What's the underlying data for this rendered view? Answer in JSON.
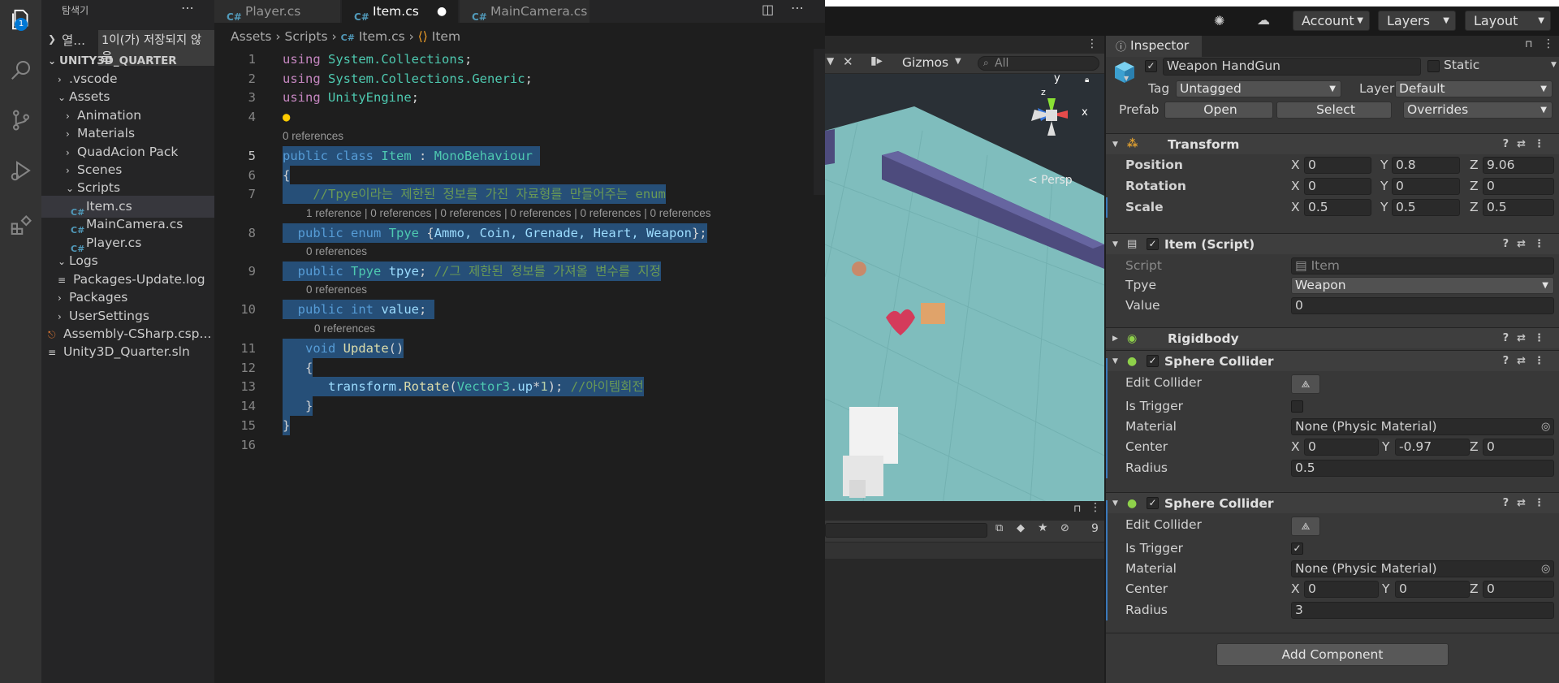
{
  "vscode": {
    "badge": "1",
    "sidebar": {
      "title": "탐색기",
      "open_editors": "열...",
      "unsaved_badge": "1이(가) 저장되지 않음",
      "project": "UNITY3D_QUARTER",
      "items": [
        {
          "label": ".vscode",
          "chev": "›"
        },
        {
          "label": "Assets",
          "chev": "⌄"
        },
        {
          "label": "Animation",
          "chev": "›"
        },
        {
          "label": "Materials",
          "chev": "›"
        },
        {
          "label": "QuadAcion Pack",
          "chev": "›"
        },
        {
          "label": "Scenes",
          "chev": "›"
        },
        {
          "label": "Scripts",
          "chev": "⌄"
        },
        {
          "label": "Item.cs",
          "icon": "C#"
        },
        {
          "label": "MainCamera.cs",
          "icon": "C#"
        },
        {
          "label": "Player.cs",
          "icon": "C#"
        },
        {
          "label": "Logs",
          "chev": "⌄"
        },
        {
          "label": "Packages-Update.log",
          "icon": "≡"
        },
        {
          "label": "Packages",
          "chev": "›"
        },
        {
          "label": "UserSettings",
          "chev": "›"
        },
        {
          "label": "Assembly-CSharp.csp...",
          "icon": "⎋"
        },
        {
          "label": "Unity3D_Quarter.sln",
          "icon": "≡"
        }
      ]
    },
    "tabs": [
      "Player.cs",
      "Item.cs",
      "MainCamera.cs"
    ],
    "breadcrumbs": {
      "p1": "Assets",
      "p2": "Scripts",
      "p3": "Item.cs",
      "p4": "Item"
    },
    "lenses": {
      "class_refs": "0 references",
      "enum_refs": "1 reference | 0 references | 0 references | 0 references | 0 references | 0 references",
      "tpye_refs": "0 references",
      "value_refs": "0 references",
      "update_refs": "0 references"
    },
    "code": {
      "l1_kw": "using",
      "l1_ns": "System.Collections",
      "l2_kw": "using",
      "l2_ns": "System.Collections.Generic",
      "l3_kw": "using",
      "l3_ns": "UnityEngine",
      "l5_kw1": "public",
      "l5_kw2": "class",
      "l5_name": "Item",
      "l5_base": "MonoBehaviour",
      "l7_comment": "//Tpye이라는 제한된 정보를 가진 자료형를 만들어주는 enum",
      "l8_kw1": "public",
      "l8_kw2": "enum",
      "l8_name": "Tpye",
      "l8_members": "Ammo, Coin, Grenade, Heart, Weapon",
      "l9_kw": "public",
      "l9_type": "Tpye",
      "l9_var": "tpye",
      "l9_comment": "//그 제한된 정보를 가져올 변수를 지정",
      "l10_kw1": "public",
      "l10_kw2": "int",
      "l10_var": "value",
      "l11_kw": "void",
      "l11_fn": "Update",
      "l13_obj": "transform",
      "l13_fn": "Rotate",
      "l13_ty": "Vector3",
      "l13_prop": "up",
      "l13_num": "1",
      "l13_comment": "//아이템회전"
    }
  },
  "unity": {
    "topbar": {
      "account": "Account",
      "layers": "Layers",
      "layout": "Layout"
    },
    "scene": {
      "gizmos": "Gizmos",
      "search_placeholder": "All",
      "persp": "< Persp",
      "axis_x": "x",
      "axis_y": "y",
      "axis_z": "z",
      "hidden_count": "9"
    },
    "inspector": {
      "tab": "Inspector",
      "object_name": "Weapon HandGun",
      "static_label": "Static",
      "tag_label": "Tag",
      "tag_value": "Untagged",
      "layer_label": "Layer",
      "layer_value": "Default",
      "prefab_label": "Prefab",
      "prefab_open": "Open",
      "prefab_select": "Select",
      "prefab_overrides": "Overrides",
      "transform": {
        "title": "Transform",
        "position_label": "Position",
        "rotation_label": "Rotation",
        "scale_label": "Scale",
        "position": [
          "0",
          "0.8",
          "9.06"
        ],
        "rotation": [
          "0",
          "0",
          "0"
        ],
        "scale": [
          "0.5",
          "0.5",
          "0.5"
        ]
      },
      "item_script": {
        "title": "Item (Script)",
        "script_label": "Script",
        "script_value": "Item",
        "tpye_label": "Tpye",
        "tpye_value": "Weapon",
        "value_label": "Value",
        "value_value": "0"
      },
      "rigidbody": {
        "title": "Rigidbody"
      },
      "sphere1": {
        "title": "Sphere Collider",
        "edit_label": "Edit Collider",
        "trigger_label": "Is Trigger",
        "trigger": "",
        "material_label": "Material",
        "material_value": "None (Physic Material)",
        "center_label": "Center",
        "center": [
          "0",
          "-0.97",
          "0"
        ],
        "radius_label": "Radius",
        "radius": "0.5"
      },
      "sphere2": {
        "title": "Sphere Collider",
        "edit_label": "Edit Collider",
        "trigger_label": "Is Trigger",
        "trigger": "✓",
        "material_label": "Material",
        "material_value": "None (Physic Material)",
        "center_label": "Center",
        "center": [
          "0",
          "0",
          "0"
        ],
        "radius_label": "Radius",
        "radius": "3"
      },
      "add_component": "Add Component",
      "axis_x": "X",
      "axis_y": "Y",
      "axis_z": "Z"
    }
  }
}
